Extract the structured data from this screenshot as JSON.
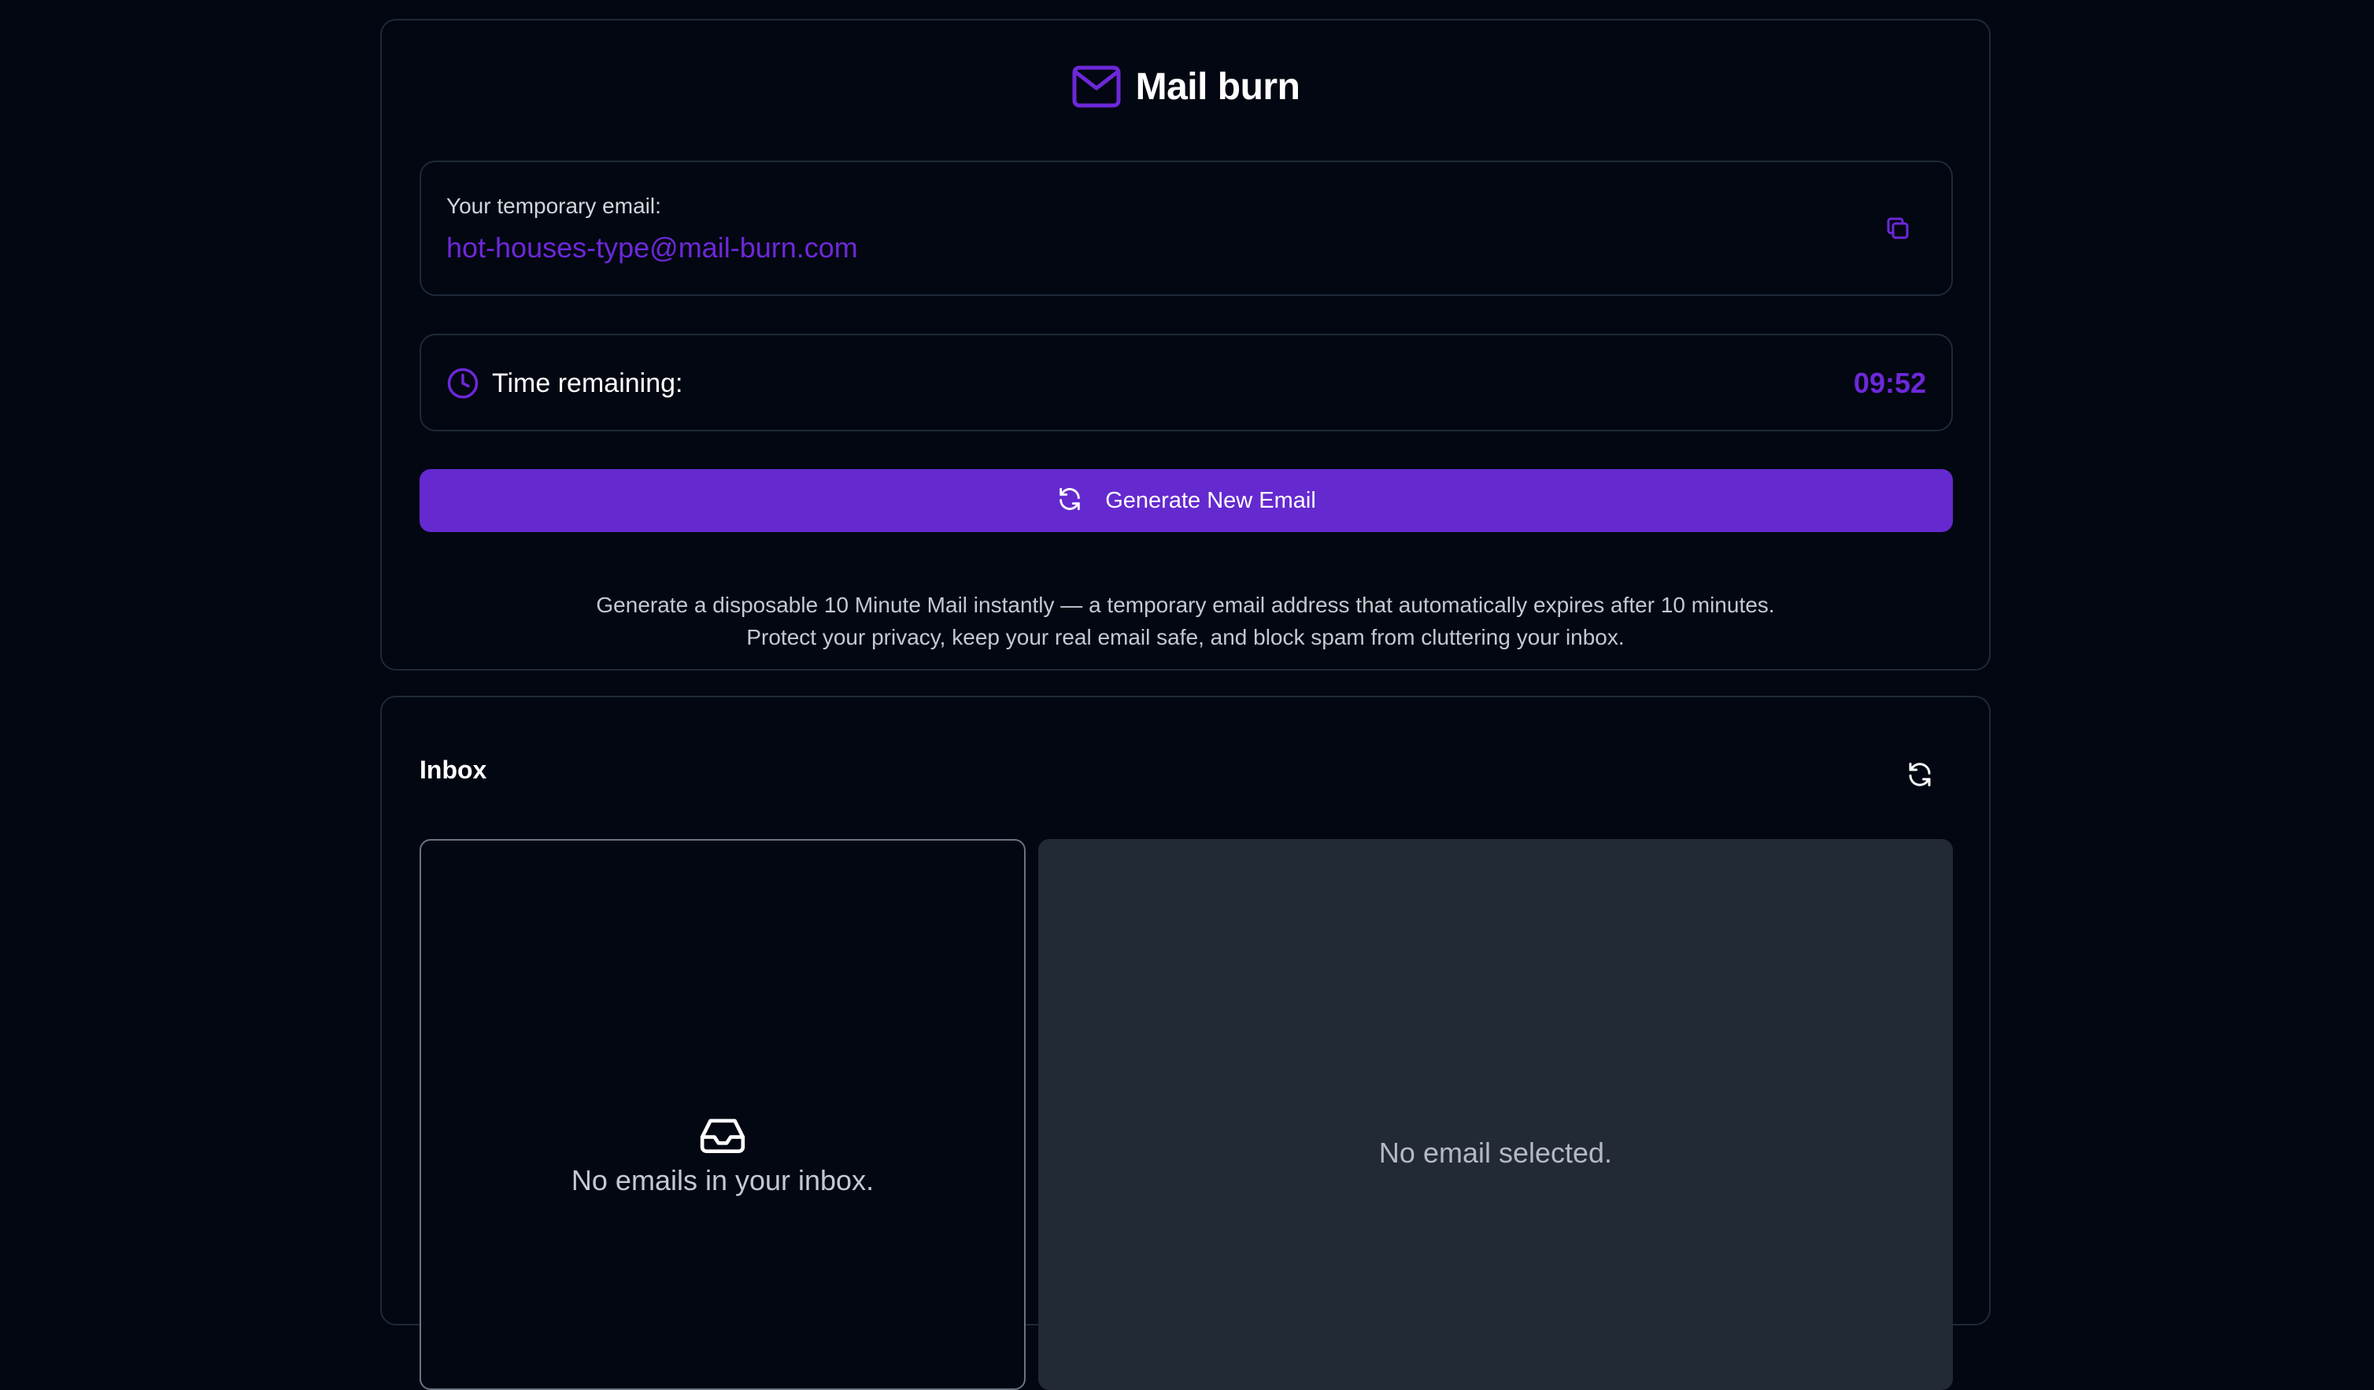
{
  "app": {
    "title": "Mail burn",
    "logo_icon": "mail-icon",
    "accent_color": "#6d28d9",
    "button_color": "#6529d0"
  },
  "email": {
    "label": "Your temporary email:",
    "address": "hot-houses-type@mail-burn.com",
    "copy_icon": "copy-icon"
  },
  "timer": {
    "label": "Time remaining:",
    "value": "09:52",
    "icon": "clock-icon"
  },
  "generate_button": {
    "label": "Generate New Email",
    "icon": "refresh-icon"
  },
  "description": {
    "line1": "Generate a disposable 10 Minute Mail instantly — a temporary email address that automatically expires after 10 minutes.",
    "line2": "Protect your privacy, keep your real email safe, and block spam from cluttering your inbox."
  },
  "inbox": {
    "title": "Inbox",
    "refresh_icon": "refresh-icon",
    "empty_icon": "inbox-tray-icon",
    "empty_text": "No emails in your inbox.",
    "viewer_empty_text": "No email selected."
  }
}
